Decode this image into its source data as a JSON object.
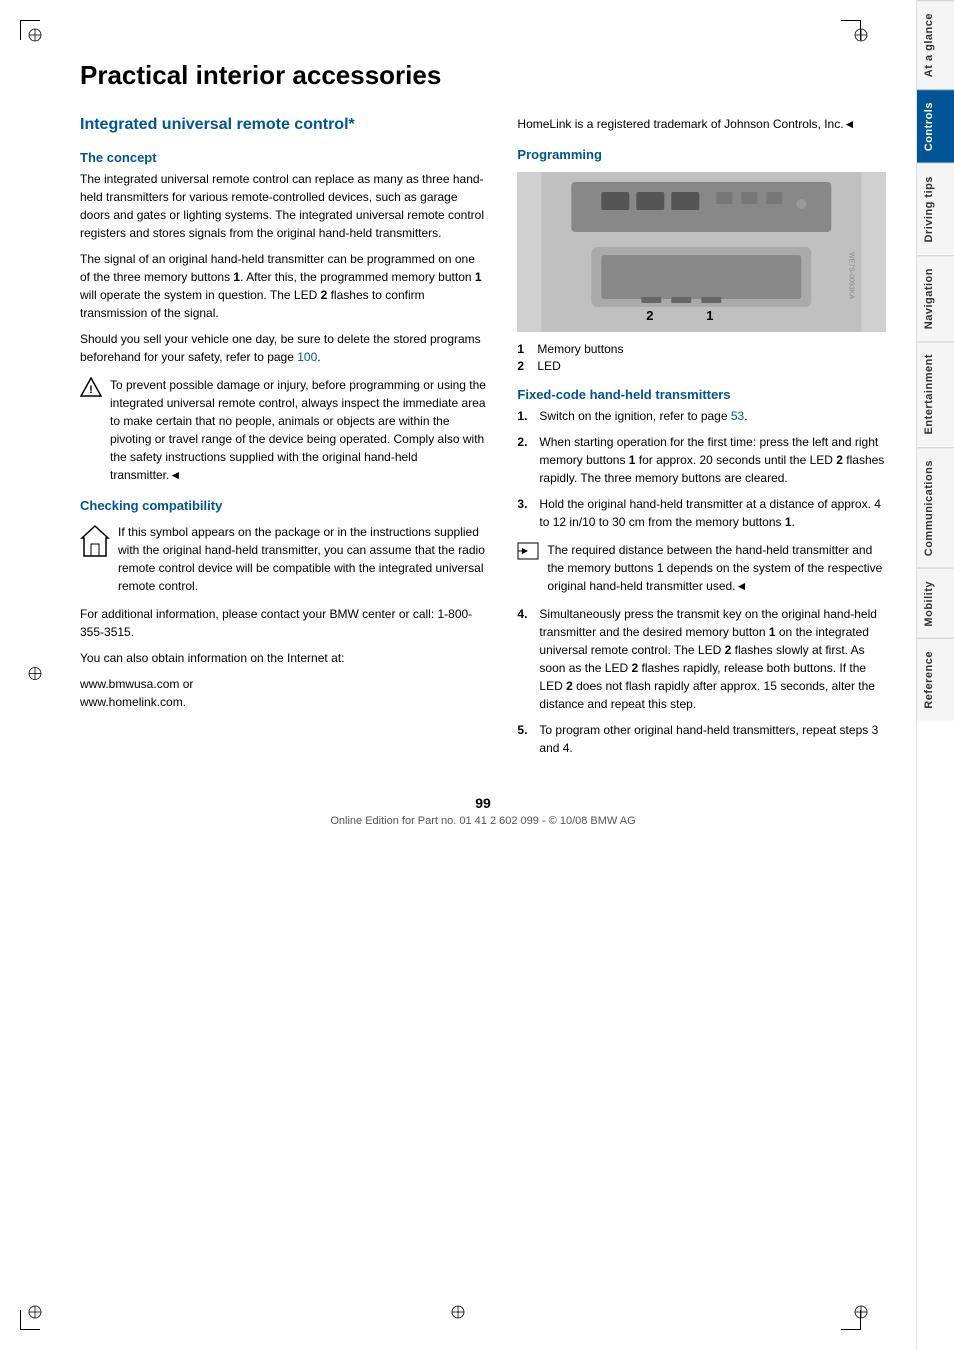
{
  "page": {
    "title": "Practical interior accessories",
    "number": "99",
    "footer": "Online Edition for Part no. 01 41 2 602 099 - © 10/08 BMW AG"
  },
  "sidebar": {
    "tabs": [
      {
        "id": "at-a-glance",
        "label": "At a glance",
        "active": false
      },
      {
        "id": "controls",
        "label": "Controls",
        "active": true
      },
      {
        "id": "driving-tips",
        "label": "Driving tips",
        "active": false
      },
      {
        "id": "navigation",
        "label": "Navigation",
        "active": false
      },
      {
        "id": "entertainment",
        "label": "Entertainment",
        "active": false
      },
      {
        "id": "communications",
        "label": "Communications",
        "active": false
      },
      {
        "id": "mobility",
        "label": "Mobility",
        "active": false
      },
      {
        "id": "reference",
        "label": "Reference",
        "active": false
      }
    ]
  },
  "left_column": {
    "section_title": "Integrated universal remote control*",
    "concept": {
      "heading": "The concept",
      "paragraphs": [
        "The integrated universal remote control can replace as many as three hand-held transmitters for various remote-controlled devices, such as garage doors and gates or lighting systems. The integrated universal remote control registers and stores signals from the original hand-held transmitters.",
        "The signal of an original hand-held transmitter can be programmed on one of the three memory buttons 1. After this, the programmed memory button 1 will operate the system in question. The LED 2 flashes to confirm transmission of the signal.",
        "Should you sell your vehicle one day, be sure to delete the stored programs beforehand for your safety, refer to page 100."
      ],
      "warning": "To prevent possible damage or injury, before programming or using the integrated universal remote control, always inspect the immediate area to make certain that no people, animals or objects are within the pivoting or travel range of the device being operated. Comply also with the safety instructions supplied with the original hand-held transmitter.◄"
    },
    "checking": {
      "heading": "Checking compatibility",
      "compat_text": "If this symbol appears on the package or in the instructions supplied with the original hand-held transmitter, you can assume that the radio remote control device will be compatible with the integrated universal remote control.",
      "paragraphs": [
        "For additional information, please contact your BMW center or call: 1-800-355-3515.",
        "You can also obtain information on the Internet at:",
        "www.bmwusa.com or\nwww.homelink.com."
      ]
    }
  },
  "right_column": {
    "homelink_text": "HomeLink is a registered trademark of Johnson Controls, Inc.◄",
    "programming": {
      "heading": "Programming",
      "legend": [
        {
          "num": "1",
          "label": "Memory buttons"
        },
        {
          "num": "2",
          "label": "LED"
        }
      ]
    },
    "fixed_code": {
      "heading": "Fixed-code hand-held transmitters",
      "steps": [
        "Switch on the ignition, refer to page 53.",
        "When starting operation for the first time: press the left and right memory buttons 1 for approx. 20 seconds until the LED 2 flashes rapidly. The three memory buttons are cleared.",
        "Hold the original hand-held transmitter at a distance of approx. 4 to 12 in/10 to 30 cm from the memory buttons 1.",
        "Simultaneously press the transmit key on the original hand-held transmitter and the desired memory button 1 on the integrated universal remote control. The LED 2 flashes slowly at first. As soon as the LED 2 flashes rapidly, release both buttons. If the LED 2 does not flash rapidly after approx. 15 seconds, alter the distance and repeat this step.",
        "To program other original hand-held transmitters, repeat steps 3 and 4."
      ],
      "note_step3": "The required distance between the hand-held transmitter and the memory buttons 1 depends on the system of the respective original hand-held transmitter used.◄"
    }
  }
}
